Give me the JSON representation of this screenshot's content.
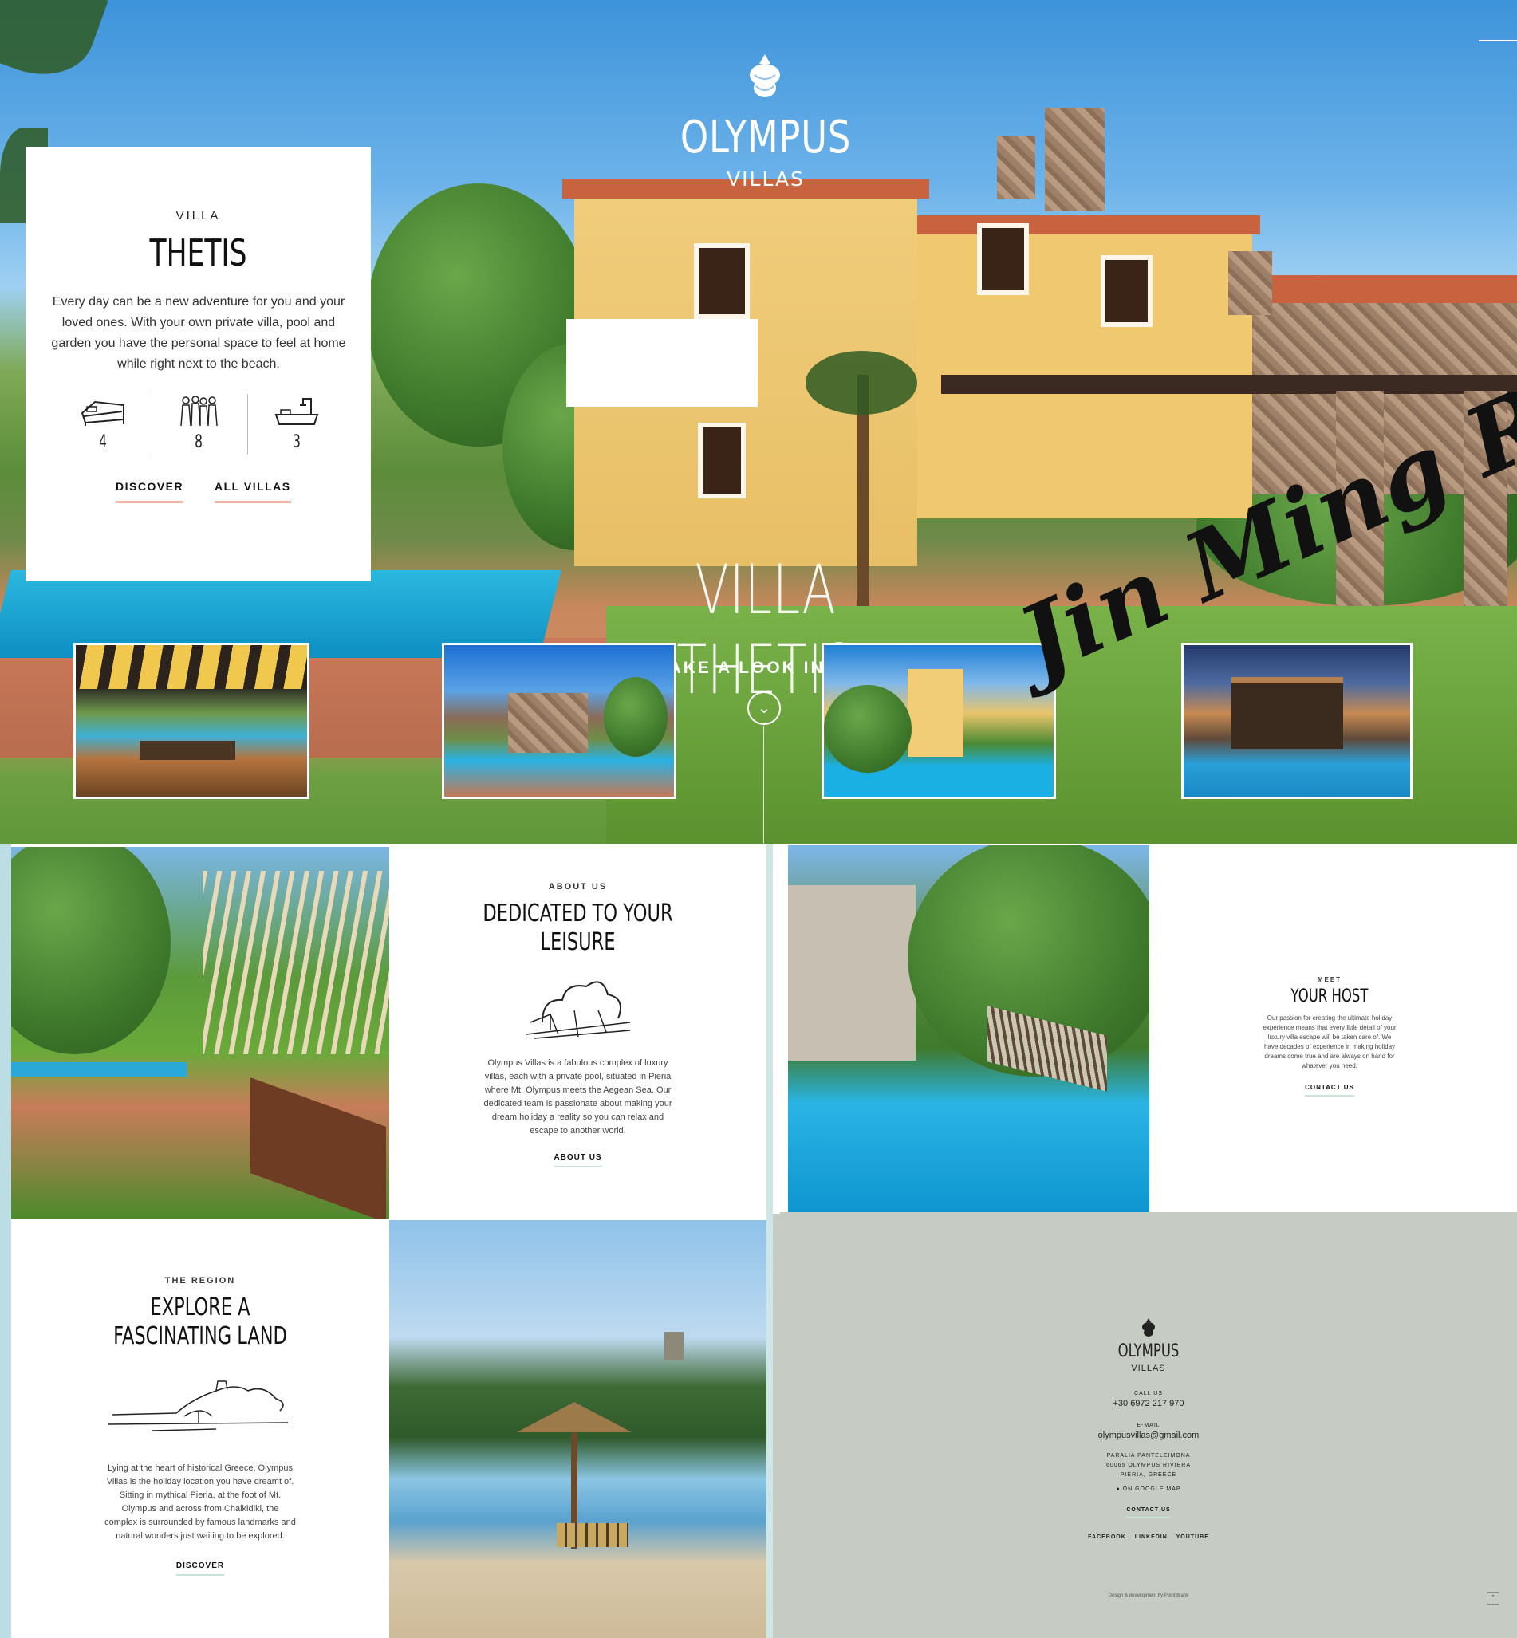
{
  "brand": {
    "name": "OLYMPUS",
    "sub": "VILLAS",
    "icon": "pinecone-icon"
  },
  "hero": {
    "title": "VILLA THETIS",
    "subtitle": "TAKE A LOOK INSIDE",
    "scroll_icon": "chevron-down-icon"
  },
  "villa_card": {
    "kicker": "VILLA",
    "title": "THETIS",
    "description": "Every day can be a new adventure for you and your loved ones. With your own private villa, pool and garden you have the personal space to feel at home while right next to the beach.",
    "features": [
      {
        "icon": "bed-icon",
        "value": "4"
      },
      {
        "icon": "people-icon",
        "value": "8"
      },
      {
        "icon": "bathtub-icon",
        "value": "3"
      }
    ],
    "links": [
      "DISCOVER",
      "ALL VILLAS"
    ],
    "accent_color": "#f4b3a3"
  },
  "signature": "Jin Ming R.",
  "about": {
    "kicker": "ABOUT US",
    "title_line1": "DEDICATED TO YOUR",
    "title_line2": "LEISURE",
    "text": "Olympus Villas is a fabulous complex of luxury villas, each with a private pool, situated in Pieria where Mt. Olympus meets the Aegean Sea. Our dedicated team is passionate about making your dream holiday a reality so you can relax and escape to another world.",
    "link": "ABOUT US"
  },
  "host": {
    "kicker": "MEET",
    "title": "YOUR HOST",
    "text": "Our passion for creating the ultimate holiday experience means that every little detail of your luxury villa escape will be taken care of. We have decades of experience in making holiday dreams come true and are always on hand for whatever you need.",
    "link": "CONTACT US"
  },
  "region": {
    "kicker": "THE REGION",
    "title_line1": "EXPLORE A",
    "title_line2": "FASCINATING LAND",
    "text": "Lying at the heart of historical Greece, Olympus Villas is the holiday location you have dreamt of. Sitting in mythical Pieria, at the foot of Mt. Olympus and across from Chalkidiki, the complex is surrounded by famous landmarks and natural wonders just waiting to be explored.",
    "link": "DISCOVER"
  },
  "footer": {
    "name": "OLYMPUS",
    "sub": "VILLAS",
    "call_label": "CALL US",
    "phone": "+30 6972 217 970",
    "email_label": "E-MAIL",
    "email": "olympusvillas@gmail.com",
    "address": [
      "PARALIA PANTELEIMONA",
      "60065 OLYMPUS RIVIERA",
      "PIERIA, GREECE"
    ],
    "map_link": "ON GOOGLE MAP",
    "contact_link": "CONTACT US",
    "social": [
      "FACEBOOK",
      "LINKEDIN",
      "YOUTUBE"
    ],
    "credit": "Design & development by Point Blank",
    "bg_color": "#c6ccc3"
  }
}
